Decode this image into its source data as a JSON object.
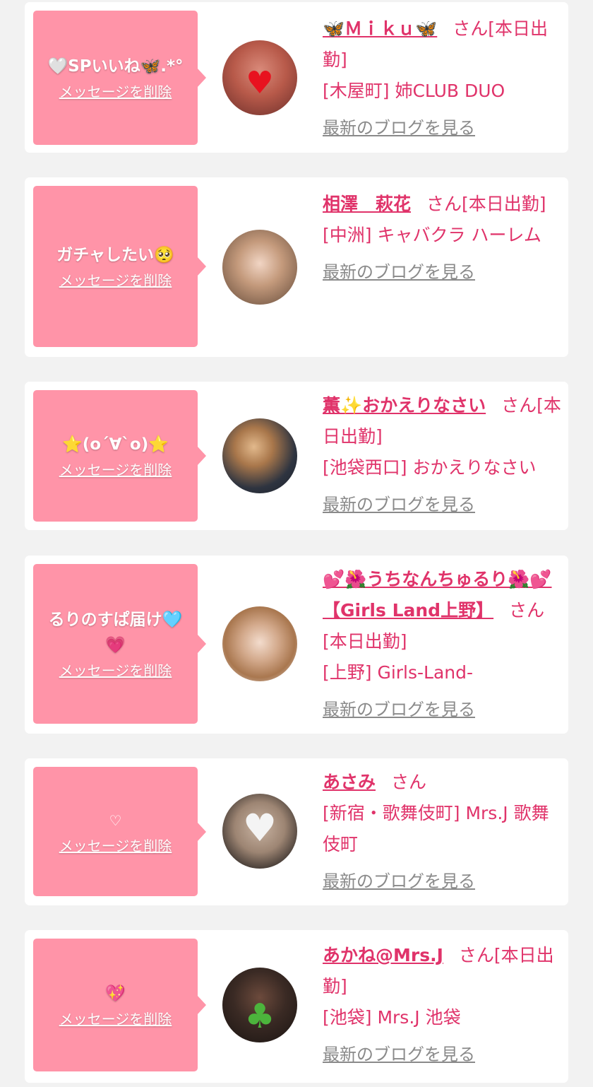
{
  "delete_label": "メッセージを削除",
  "blog_label": "最新のブログを見る",
  "san_label": "さん",
  "today_label": "[本日出勤]",
  "colors": {
    "bubble": "#ff94a8",
    "name": "#e0336a",
    "link_gray": "#8a8a8a",
    "background": "#f2f2f2"
  },
  "entries": [
    {
      "message": "🤍SPいいね🦋.*°",
      "name": "🦋Ｍｉｋｕ🦋",
      "shop": "[木屋町] 姉CLUB DUO",
      "avatar_overlay": "heart-sticker-icon"
    },
    {
      "message": "ガチャしたい🥺",
      "name": "相澤　萩花",
      "shop": "[中洲] キャバクラ ハーレム",
      "avatar_overlay": ""
    },
    {
      "message": "⭐(o´∀`o)⭐",
      "name": "薫✨おかえりなさい",
      "shop": "[池袋西口] おかえりなさい",
      "avatar_overlay": ""
    },
    {
      "message": "るりのすぱ届け🩵💗",
      "name": "💕🌺うちなんちゅるり🌺💕【Girls Land上野】",
      "shop": "[上野] Girls-Land-",
      "avatar_overlay": ""
    },
    {
      "message": "♡",
      "name": "あさみ",
      "shop": "[新宿・歌舞伎町] Mrs.J 歌舞伎町",
      "avatar_overlay": "white-heart-sticker-icon"
    },
    {
      "message": "💖",
      "name": "あかね@Mrs.J",
      "shop": "[池袋] Mrs.J 池袋",
      "avatar_overlay": "clover-sticker-icon"
    }
  ]
}
